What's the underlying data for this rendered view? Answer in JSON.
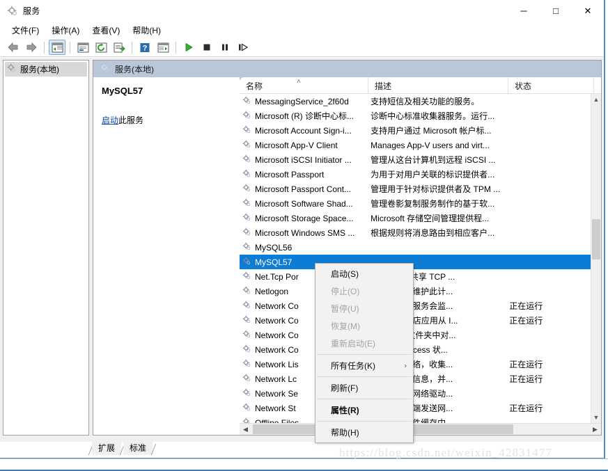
{
  "window": {
    "title": "服务",
    "icon": "services-gear-icon",
    "controls": {
      "minimize": "─",
      "maximize": "□",
      "close": "✕"
    }
  },
  "menubar": {
    "items": [
      {
        "label": "文件(F)",
        "name": "menu-file"
      },
      {
        "label": "操作(A)",
        "name": "menu-action"
      },
      {
        "label": "查看(V)",
        "name": "menu-view"
      },
      {
        "label": "帮助(H)",
        "name": "menu-help"
      }
    ]
  },
  "toolbar": {
    "buttons": [
      {
        "name": "back-icon",
        "glyph": "back-arrow"
      },
      {
        "name": "forward-icon",
        "glyph": "forward-arrow"
      },
      {
        "name": "show-hide-console-tree-icon",
        "glyph": "tree-pane",
        "active": true
      },
      {
        "name": "properties-icon",
        "glyph": "properties-window"
      },
      {
        "name": "refresh-icon",
        "glyph": "refresh-circle"
      },
      {
        "name": "export-list-icon",
        "glyph": "export-list"
      },
      {
        "name": "help-icon",
        "glyph": "question-mark"
      },
      {
        "name": "show-hide-action-pane-icon",
        "glyph": "action-pane"
      },
      {
        "name": "start-service-icon",
        "glyph": "play-triangle"
      },
      {
        "name": "stop-service-icon",
        "glyph": "stop-square"
      },
      {
        "name": "pause-service-icon",
        "glyph": "pause-bars"
      },
      {
        "name": "restart-service-icon",
        "glyph": "restart-arrow"
      }
    ]
  },
  "tree": {
    "root": {
      "label": "服务(本地)",
      "icon": "services-gear-icon"
    }
  },
  "pane": {
    "header": {
      "label": "服务(本地)",
      "icon": "services-gear-icon"
    }
  },
  "details": {
    "service_name": "MySQL57",
    "action_link": "启动",
    "action_suffix": "此服务"
  },
  "list": {
    "columns": [
      {
        "label": "名称",
        "name": "column-name",
        "sorted": true,
        "sort_glyph": "˄"
      },
      {
        "label": "描述",
        "name": "column-description"
      },
      {
        "label": "状态",
        "name": "column-status"
      }
    ],
    "rows": [
      {
        "name": "MessagingService_2f60d",
        "desc": "支持短信及相关功能的服务。",
        "status": ""
      },
      {
        "name": "Microsoft (R) 诊断中心标...",
        "desc": "诊断中心标准收集器服务。运行...",
        "status": ""
      },
      {
        "name": "Microsoft Account Sign-i...",
        "desc": "支持用户通过 Microsoft 帐户标...",
        "status": ""
      },
      {
        "name": "Microsoft App-V Client",
        "desc": "Manages App-V users and virt...",
        "status": ""
      },
      {
        "name": "Microsoft iSCSI Initiator ...",
        "desc": "管理从这台计算机到远程 iSCSI ...",
        "status": ""
      },
      {
        "name": "Microsoft Passport",
        "desc": "为用于对用户关联的标识提供者...",
        "status": ""
      },
      {
        "name": "Microsoft Passport Cont...",
        "desc": "管理用于针对标识提供者及 TPM ...",
        "status": ""
      },
      {
        "name": "Microsoft Software Shad...",
        "desc": "管理卷影复制服务制作的基于软...",
        "status": ""
      },
      {
        "name": "Microsoft Storage Space...",
        "desc": "Microsoft 存储空间管理提供程...",
        "status": ""
      },
      {
        "name": "Microsoft Windows SMS ...",
        "desc": "根据规则将消息路由到相应客户...",
        "status": ""
      },
      {
        "name": "MySQL56",
        "desc": "",
        "status": ""
      },
      {
        "name": "MySQL57",
        "desc": "",
        "status": "",
        "selected": true
      },
      {
        "name": "Net.Tcp Por",
        "desc": "et.tcp 协议共享 TCP ...",
        "status": ""
      },
      {
        "name": "Netlogon",
        "desc": "务身份验证维护此计...",
        "status": ""
      },
      {
        "name": "Network Co",
        "desc": "备自动安装服务会监...",
        "status": "正在运行"
      },
      {
        "name": "Network Co",
        "desc": "ows 应用商店应用从 I...",
        "status": "正在运行"
      },
      {
        "name": "Network Co",
        "desc": "拨号连接\"文件夹中对...",
        "status": ""
      },
      {
        "name": "Network Co",
        "desc": "的 DirectAccess 状...",
        "status": ""
      },
      {
        "name": "Network Lis",
        "desc": "已连接的网络，收集...",
        "status": "正在运行"
      },
      {
        "name": "Network Lc",
        "desc": "网络的配置信息，并...",
        "status": "正在运行"
      },
      {
        "name": "Network Se",
        "desc": "务用于管理网络驱动...",
        "status": ""
      },
      {
        "name": "Network St",
        "desc": "中模式客户端发送网...",
        "status": "正在运行"
      },
      {
        "name": "Offline Files",
        "desc": "务在脱机文件缓存中",
        "status": ""
      }
    ]
  },
  "context_menu": {
    "items": [
      {
        "label": "启动(S)",
        "name": "context-start",
        "disabled": false,
        "bold": false
      },
      {
        "label": "停止(O)",
        "name": "context-stop",
        "disabled": true,
        "bold": false
      },
      {
        "label": "暂停(U)",
        "name": "context-pause",
        "disabled": true,
        "bold": false
      },
      {
        "label": "恢复(M)",
        "name": "context-resume",
        "disabled": true,
        "bold": false
      },
      {
        "label": "重新启动(E)",
        "name": "context-restart",
        "disabled": true,
        "bold": false
      },
      {
        "separator": true
      },
      {
        "label": "所有任务(K)",
        "name": "context-all-tasks",
        "disabled": false,
        "bold": false,
        "submenu": true,
        "submenu_glyph": "›"
      },
      {
        "separator": true
      },
      {
        "label": "刷新(F)",
        "name": "context-refresh",
        "disabled": false,
        "bold": false
      },
      {
        "separator": true
      },
      {
        "label": "属性(R)",
        "name": "context-properties",
        "disabled": false,
        "bold": true
      },
      {
        "separator": true
      },
      {
        "label": "帮助(H)",
        "name": "context-help",
        "disabled": false,
        "bold": false
      }
    ]
  },
  "tabs": [
    {
      "label": "扩展",
      "name": "tab-extended",
      "active": false
    },
    {
      "label": "标准",
      "name": "tab-standard",
      "active": true
    }
  ],
  "watermark": "https://blog.csdn.net/weixin_42831477",
  "colors": {
    "selection_blue": "#0c7cd5",
    "link_blue": "#0645ad",
    "pane_header": "#b9c7da",
    "window_border": "#4a8cc7"
  }
}
